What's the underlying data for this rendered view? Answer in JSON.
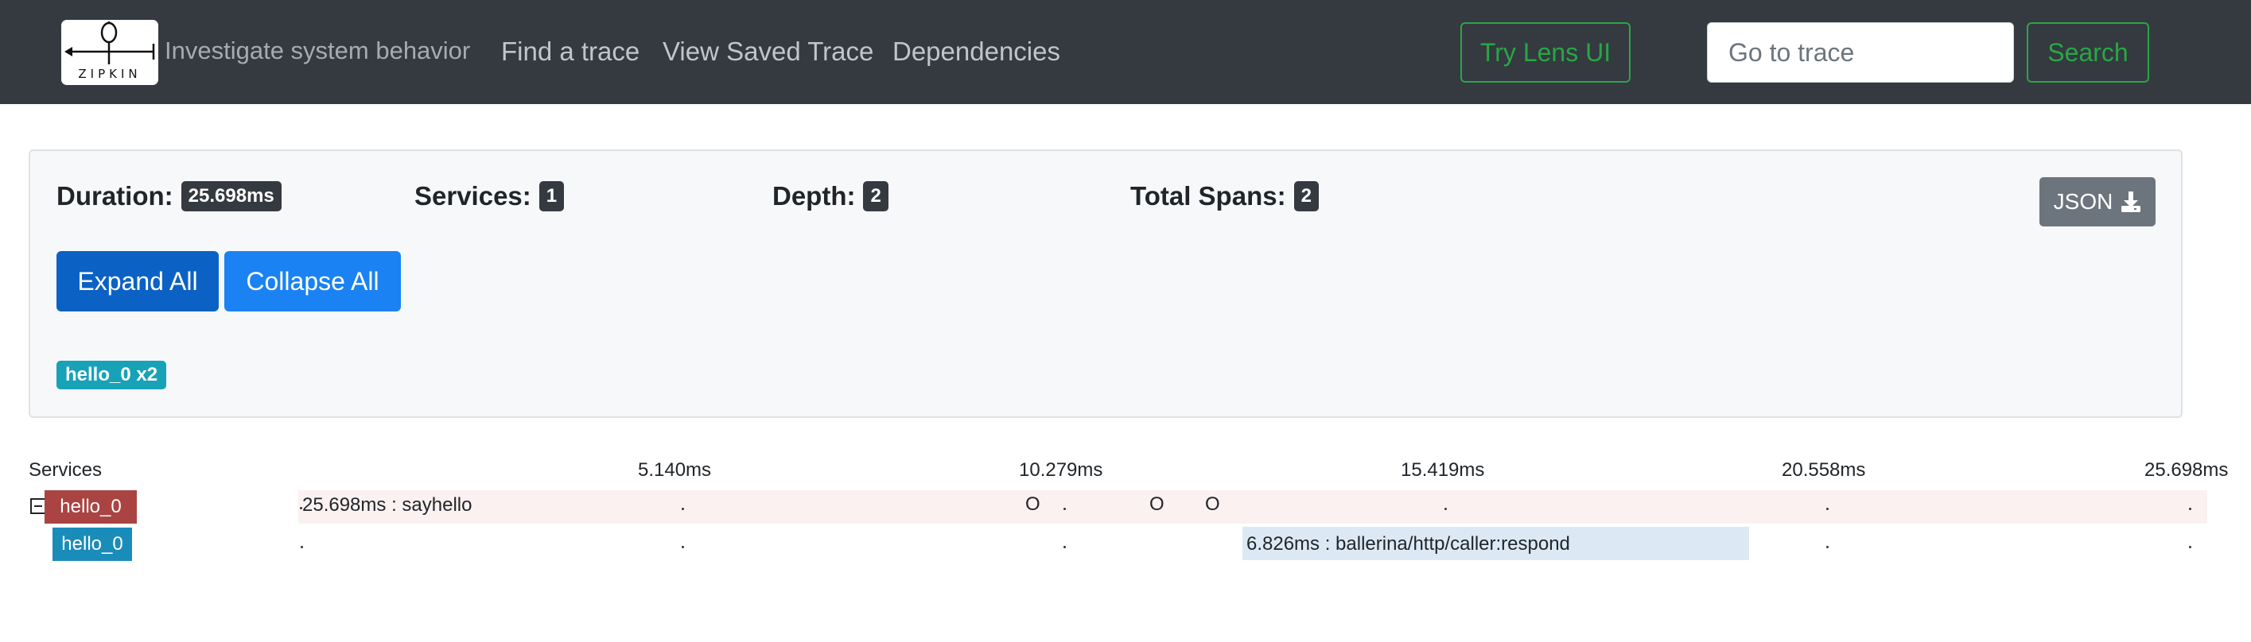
{
  "navbar": {
    "logo_text": "ZIPKIN",
    "tagline": "Investigate system behavior",
    "links": [
      "Find a trace",
      "View Saved Trace",
      "Dependencies"
    ],
    "lens_button": "Try Lens UI",
    "trace_input_placeholder": "Go to trace",
    "search_button": "Search"
  },
  "summary": {
    "duration_label": "Duration:",
    "duration_value": "25.698ms",
    "services_label": "Services:",
    "services_value": "1",
    "depth_label": "Depth:",
    "depth_value": "2",
    "total_spans_label": "Total Spans:",
    "total_spans_value": "2",
    "json_button": "JSON",
    "expand_all": "Expand All",
    "collapse_all": "Collapse All",
    "service_badges": [
      "hello_0 x2"
    ]
  },
  "timeline": {
    "services_header": "Services",
    "ticks": [
      "5.140ms",
      "10.279ms",
      "15.419ms",
      "20.558ms",
      "25.698ms"
    ],
    "rows": [
      {
        "service": "hello_0",
        "label": "25.698ms : sayhello",
        "annotations": [
          "O",
          "O",
          "O"
        ]
      },
      {
        "service": "hello_0",
        "label": "6.826ms : ballerina/http/caller:respond"
      }
    ]
  },
  "colors": {
    "navbar_bg": "#343a40",
    "accent_green": "#28a745",
    "root_service": "#a94442",
    "child_service": "#1a8cba",
    "root_row_bg": "#fbf1f1",
    "child_span_bg": "#dce9f5"
  }
}
